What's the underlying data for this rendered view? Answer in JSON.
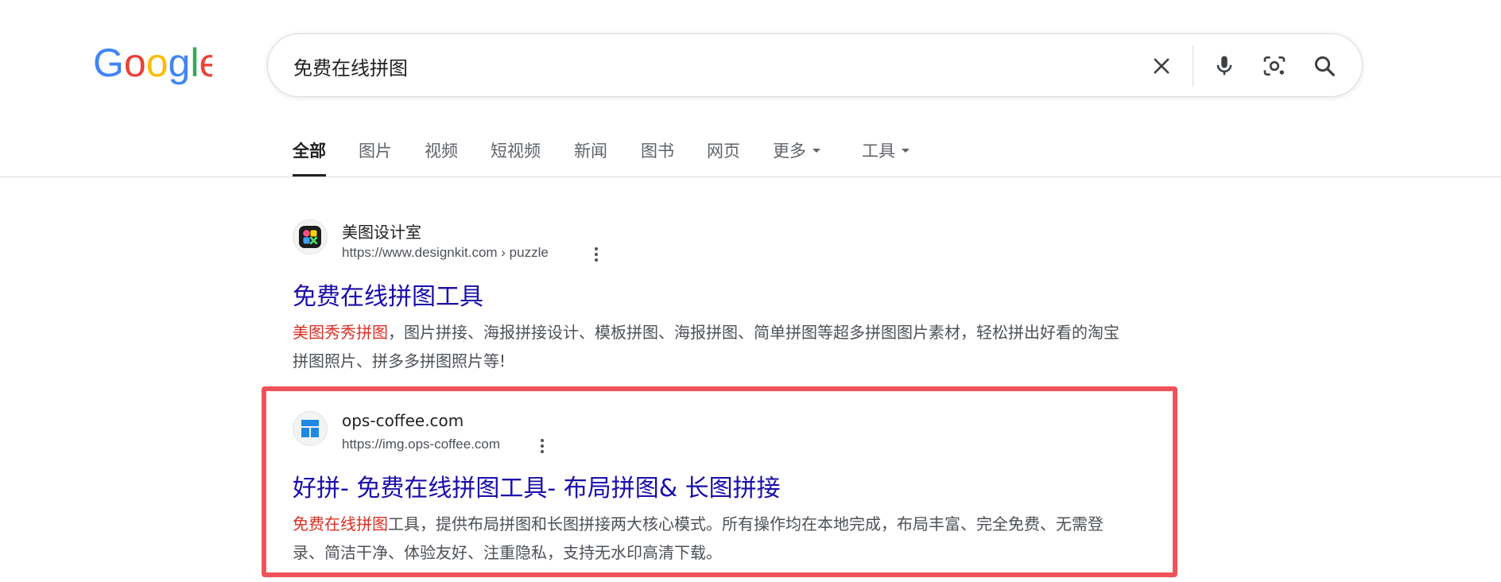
{
  "logo": {
    "text": "Google"
  },
  "search": {
    "query": "免费在线拼图",
    "placeholder": ""
  },
  "tabs": [
    {
      "label": "全部",
      "active": true
    },
    {
      "label": "图片"
    },
    {
      "label": "视频"
    },
    {
      "label": "短视频"
    },
    {
      "label": "新闻"
    },
    {
      "label": "图书"
    },
    {
      "label": "网页"
    },
    {
      "label": "更多",
      "dropdown": true
    },
    {
      "label": "工具",
      "dropdown": true
    }
  ],
  "results": [
    {
      "site_name": "美图设计室",
      "url": "https://www.designkit.com › puzzle",
      "title": "免费在线拼图工具",
      "snippet_highlight": "美图秀秀拼图",
      "snippet_rest": "，图片拼接、海报拼接设计、模板拼图、海报拼图、简单拼图等超多拼图图片素材，轻松拼出好看的淘宝拼图照片、拼多多拼图照片等!"
    },
    {
      "site_name": "ops-coffee.com",
      "url": "https://img.ops-coffee.com",
      "title": "好拼- 免费在线拼图工具- 布局拼图& 长图拼接",
      "snippet_highlight": "免费在线拼图",
      "snippet_rest": "工具，提供布局拼图和长图拼接两大核心模式。所有操作均在本地完成，布局丰富、完全免费、无需登录、简洁干净、体验友好、注重隐私，支持无水印高清下载。"
    }
  ],
  "colors": {
    "link": "#1a0dab",
    "highlight_text": "#d93025",
    "annotation_box": "#f0525a"
  }
}
